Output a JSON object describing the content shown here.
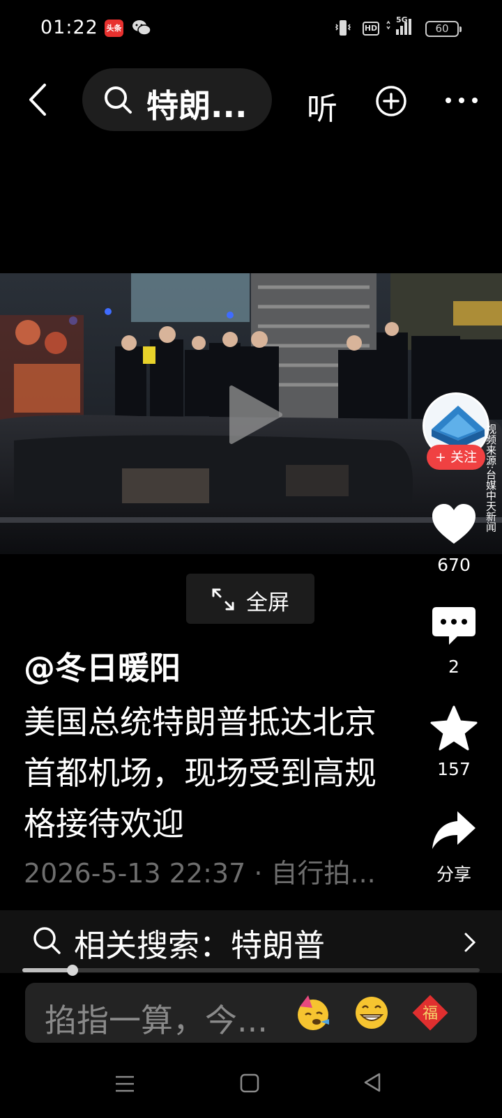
{
  "status_bar": {
    "time": "01:22",
    "app_badge": "头条",
    "hd": "HD",
    "network": "5G",
    "battery": "60"
  },
  "top_bar": {
    "search_query": "特朗...",
    "listen_label": "听"
  },
  "video": {
    "watermark": "视频来源:台媒中天新闻",
    "fullscreen_label": "全屏"
  },
  "side_actions": {
    "follow_label": "+ 关注",
    "like_count": "670",
    "comment_count": "2",
    "favorite_count": "157",
    "share_label": "分享"
  },
  "post": {
    "author": "@冬日暖阳",
    "description": "美国总统特朗普抵达北京首都机场，现场受到高规格接待欢迎",
    "meta": "2026-5-13 22:37 · 自行拍..."
  },
  "related_search": {
    "label": "相关搜索：特朗普",
    "progress": 0.11
  },
  "comment_input": {
    "placeholder": "掐指一算，今..."
  },
  "colors": {
    "follow_red": "#f04142",
    "background": "#000000"
  },
  "icons": [
    "back-icon",
    "search-icon",
    "add-circle-icon",
    "more-icon",
    "play-icon",
    "heart-icon",
    "comment-icon",
    "star-icon",
    "share-icon",
    "fullscreen-icon",
    "chevron-right-icon",
    "emoji-party-icon",
    "emoji-grin-icon",
    "fu-icon",
    "nav-menu-icon",
    "nav-home-icon",
    "nav-back-icon"
  ]
}
